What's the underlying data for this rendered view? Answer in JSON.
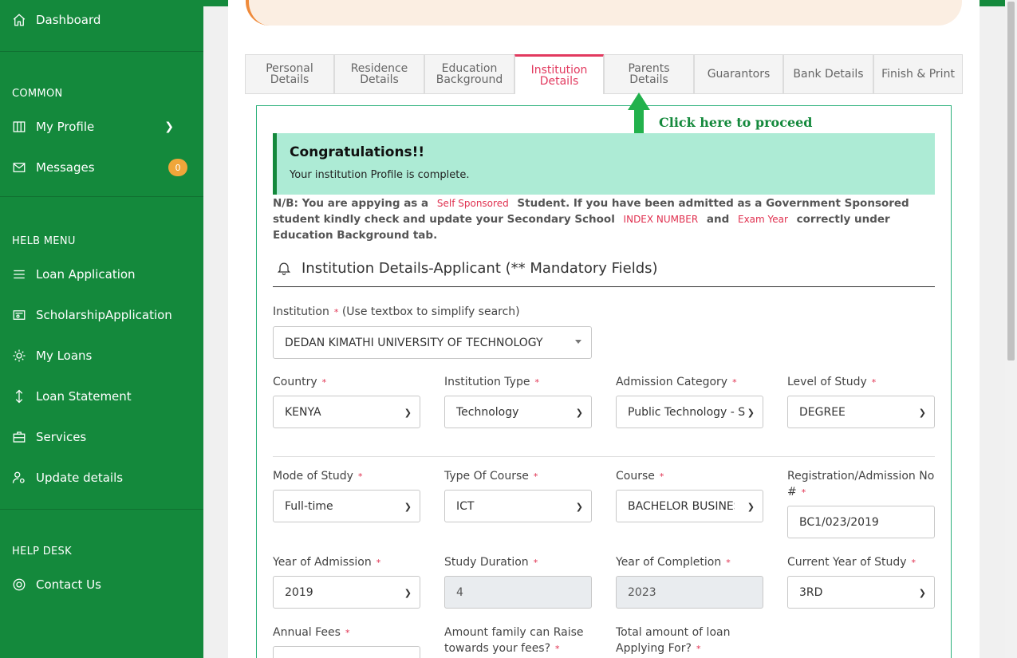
{
  "sidebar": {
    "dashboard": "Dashboard",
    "section_common": "COMMON",
    "my_profile": "My Profile",
    "messages": "Messages",
    "messages_count": "0",
    "section_helb": "HELB MENU",
    "loan_application": "Loan Application",
    "scholarship_application": "ScholarshipApplication",
    "my_loans": "My Loans",
    "loan_statement": "Loan Statement",
    "services": "Services",
    "update_details": "Update details",
    "section_help": "HELP DESK",
    "contact_us": "Contact Us"
  },
  "tabs": {
    "personal": [
      "Personal",
      "Details"
    ],
    "residence": [
      "Residence",
      "Details"
    ],
    "education": [
      "Education",
      "Background"
    ],
    "institution": [
      "Institution",
      "Details"
    ],
    "parents": [
      "Parents",
      "Details"
    ],
    "guarantors": "Guarantors",
    "bank": "Bank Details",
    "finish": "Finish & Print"
  },
  "hint": "Click here to proceed",
  "alert": {
    "title": "Congratulations!!",
    "text": "Your institution Profile is complete."
  },
  "note": {
    "p1": "N/B: You are appying as a",
    "tag_sponsor": "Self Sponsored",
    "p2": "Student. If you have been admitted as a Government Sponsored student kindly check and update your Secondary School",
    "tag_index": "INDEX NUMBER",
    "p3": "and",
    "tag_year": "Exam Year",
    "p4": "correctly under Education Background tab."
  },
  "section_title": "Institution Details-Applicant (** Mandatory Fields)",
  "form": {
    "institution_label": "Institution",
    "institution_hint": "(Use textbox to simplify search)",
    "institution_value": "DEDAN KIMATHI UNIVERSITY OF TECHNOLOGY",
    "country_label": "Country",
    "country_value": "KENYA",
    "inst_type_label": "Institution Type",
    "inst_type_value": "Technology",
    "adm_cat_label": "Admission Category",
    "adm_cat_value": "Public Technology - S",
    "level_label": "Level of Study",
    "level_value": "DEGREE",
    "mode_label": "Mode of Study",
    "mode_value": "Full-time",
    "course_type_label": "Type Of Course",
    "course_type_value": "ICT",
    "course_label": "Course",
    "course_value": "BACHELOR BUSINESS",
    "reg_label": "Registration/Admission No #",
    "reg_value": "BC1/023/2019",
    "year_adm_label": "Year of Admission",
    "year_adm_value": "2019",
    "duration_label": "Study Duration",
    "duration_value": "4",
    "year_comp_label": "Year of Completion",
    "year_comp_value": "2023",
    "current_year_label": "Current Year of Study",
    "current_year_value": "3RD",
    "fees_label": "Annual Fees",
    "family_label": "Amount family can Raise towards your fees?",
    "loan_label": "Total amount of loan Applying For?",
    "required_mark": "*"
  }
}
